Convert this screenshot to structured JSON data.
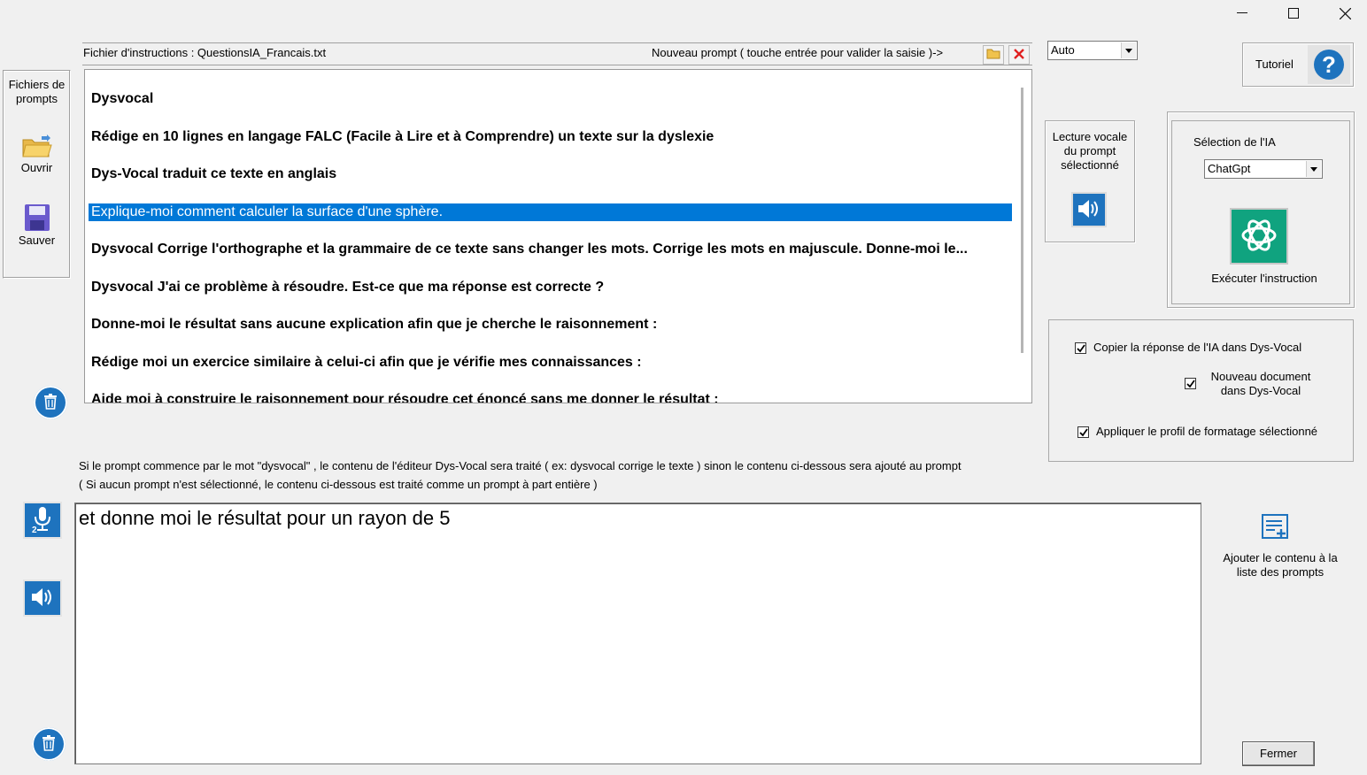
{
  "window": {
    "minimize_icon": "minimize-icon",
    "maximize_icon": "maximize-icon",
    "close_icon": "close-icon"
  },
  "left_panel": {
    "title": "Fichiers de prompts",
    "open_label": "Ouvrir",
    "save_label": "Sauver"
  },
  "header": {
    "file_label": "Fichier d'instructions : QuestionsIA_Francais.txt",
    "new_prompt_label": "Nouveau prompt  ( touche entrée pour valider la saisie )->"
  },
  "prompts": [
    "Dysvocal",
    "Rédige en 10 lignes en langage FALC (Facile à Lire et à Comprendre) un texte sur la dyslexie",
    "Dys-Vocal traduit ce texte en anglais",
    "Explique-moi comment calculer la surface d'une sphère.",
    "Dysvocal Corrige l'orthographe et la grammaire de ce texte sans changer les mots. Corrige les mots en majuscule. Donne-moi le...",
    "Dysvocal J'ai ce problème à résoudre. Est-ce que ma réponse est correcte ?",
    "Donne-moi le résultat sans aucune explication afin que je cherche le raisonnement :",
    "Rédige moi un exercice similaire à celui-ci afin que je vérifie mes connaissances :",
    "Aide moi à construire le raisonnement pour résoudre cet énoncé sans me donner le résultat :"
  ],
  "language_combo": {
    "value": "Auto"
  },
  "tutorial": {
    "label": "Tutoriel"
  },
  "read_aloud": {
    "label": "Lecture vocale du prompt sélectionné"
  },
  "ai_selection": {
    "label": "Sélection de l'IA",
    "value": "ChatGpt",
    "execute_label": "Exécuter l'instruction"
  },
  "options": {
    "copy_response": "Copier la réponse de l'IA dans Dys-Vocal",
    "new_document": "Nouveau document dans Dys-Vocal",
    "apply_profile": "Appliquer le profil de formatage sélectionné"
  },
  "notes": {
    "line1": "Si le prompt commence par le mot \"dysvocal\" , le contenu de l'éditeur Dys-Vocal sera traité ( ex: dysvocal  corrige le texte  ) sinon le contenu ci-dessous sera ajouté au prompt",
    "line2": "( Si aucun prompt n'est sélectionné, le contenu ci-dessous est traité comme un prompt à part entière )"
  },
  "editor": {
    "text": "et donne moi le résultat pour un rayon de 5"
  },
  "add_to_list": {
    "label": "Ajouter le contenu à la liste des prompts"
  },
  "close_button": {
    "label": "Fermer"
  },
  "colors": {
    "selection": "#0078d7",
    "accent_blue": "#1e73be",
    "chatgpt_green": "#10a37f"
  }
}
